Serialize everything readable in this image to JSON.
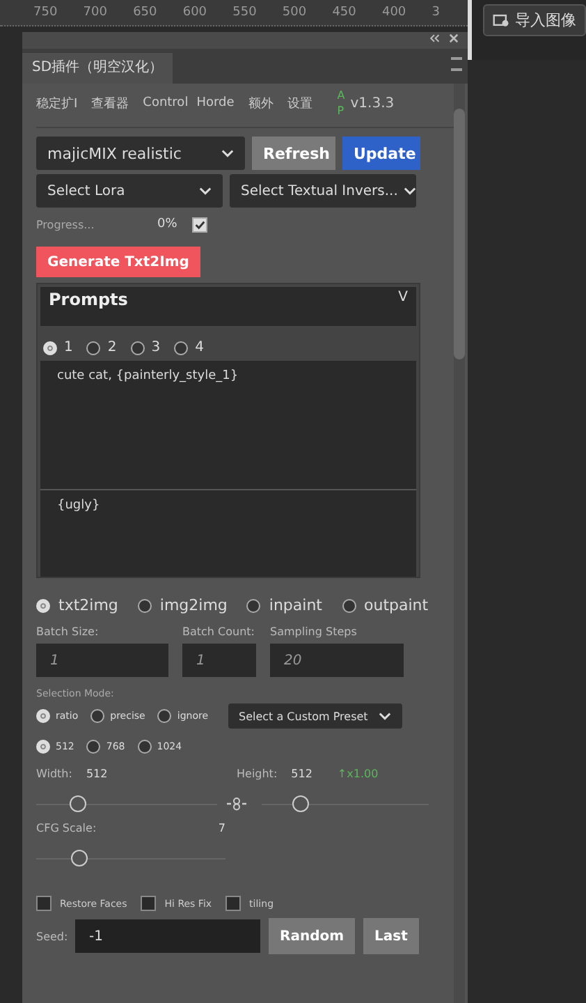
{
  "ruler": {
    "marks": [
      "750",
      "700",
      "650",
      "600",
      "550",
      "500",
      "450",
      "400",
      "3"
    ]
  },
  "toolbar": {
    "import_button": "导入图像"
  },
  "panel": {
    "title": "SD插件（明空汉化）",
    "tabs": [
      {
        "label": "稳定扩I"
      },
      {
        "label": "查看器"
      },
      {
        "label": "Control"
      },
      {
        "label": "Horde"
      },
      {
        "label": "额外"
      },
      {
        "label": "设置"
      }
    ],
    "status_letters": [
      "A",
      "P"
    ],
    "version": "v1.3.3"
  },
  "model": {
    "value": "majicMIX realistic"
  },
  "buttons": {
    "refresh": "Refresh",
    "update": "Update",
    "generate": "Generate Txt2Img",
    "random": "Random",
    "last": "Last"
  },
  "lora": {
    "value": "Select Lora"
  },
  "textual_inversion": {
    "value": "Select Textual Invers..."
  },
  "progress": {
    "label": "Progress...",
    "reading": "0%",
    "checked": true
  },
  "prompts": {
    "title": "Prompts",
    "toggle": "V",
    "slots": [
      {
        "label": "1",
        "selected": true
      },
      {
        "label": "2",
        "selected": false
      },
      {
        "label": "3",
        "selected": false
      },
      {
        "label": "4",
        "selected": false
      }
    ],
    "positive": "cute cat, {painterly_style_1}",
    "negative": "{ugly}"
  },
  "modes": [
    {
      "label": "txt2img",
      "selected": true
    },
    {
      "label": "img2img",
      "selected": false
    },
    {
      "label": "inpaint",
      "selected": false
    },
    {
      "label": "outpaint",
      "selected": false
    }
  ],
  "batch": [
    {
      "label": "Batch Size:",
      "placeholder": "1"
    },
    {
      "label": "Batch Count:",
      "placeholder": "1"
    },
    {
      "label": "Sampling Steps",
      "placeholder": "20"
    }
  ],
  "selection_mode": {
    "label": "Selection Mode:",
    "options": [
      {
        "label": "ratio",
        "selected": true
      },
      {
        "label": "precise",
        "selected": false
      },
      {
        "label": "ignore",
        "selected": false
      }
    ],
    "preset": "Select a Custom Preset"
  },
  "sizes": [
    {
      "label": "512",
      "selected": true
    },
    {
      "label": "768",
      "selected": false
    },
    {
      "label": "1024",
      "selected": false
    }
  ],
  "width": {
    "label": "Width:",
    "reading": "512",
    "level": 0.23
  },
  "height": {
    "label": "Height:",
    "reading": "512",
    "ratio": "↑x1.00",
    "level": 0.23
  },
  "cfg": {
    "label": "CFG Scale:",
    "reading": "7",
    "level": 0.23
  },
  "options": [
    {
      "label": "Restore Faces",
      "checked": false
    },
    {
      "label": "Hi Res Fix",
      "checked": false
    },
    {
      "label": "tiling",
      "checked": false
    }
  ],
  "seed": {
    "label": "Seed:",
    "value": "-1"
  }
}
